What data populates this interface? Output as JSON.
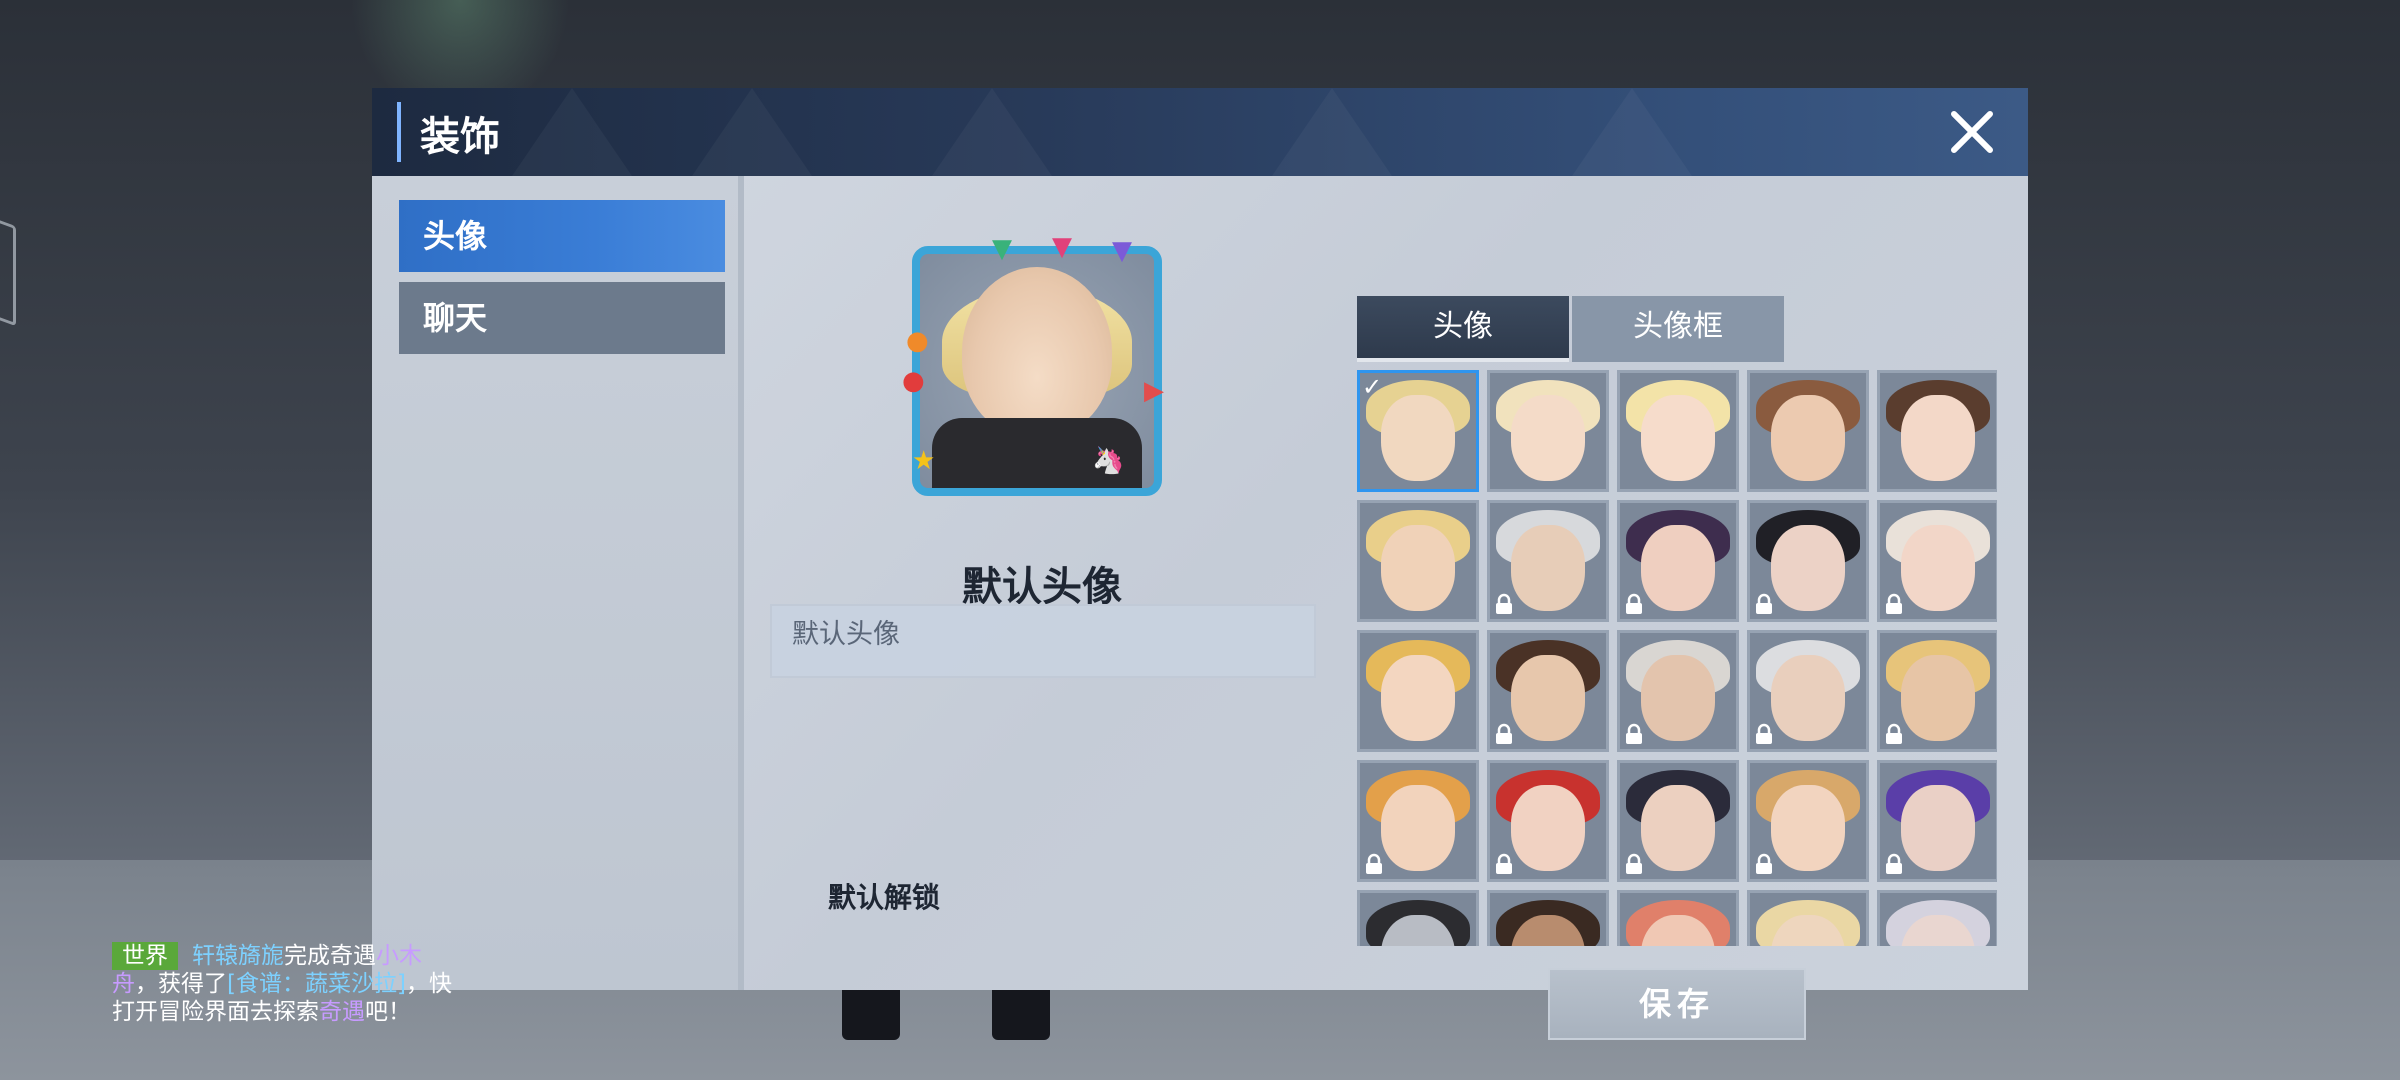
{
  "dialog": {
    "title": "装饰",
    "close_label": "close"
  },
  "sidebar": {
    "items": [
      {
        "label": "头像",
        "active": true
      },
      {
        "label": "聊天",
        "active": false
      }
    ]
  },
  "preview": {
    "name": "默认头像",
    "description": "默认头像",
    "unlock_condition": "默认解锁"
  },
  "tabs": [
    {
      "label": "头像",
      "active": true
    },
    {
      "label": "头像框",
      "active": false
    }
  ],
  "avatar_grid": {
    "rows": 5,
    "cols": 5,
    "selected_index": 0,
    "items": [
      {
        "hair": "#e6d292",
        "skin": "#f1d8c0",
        "locked": false
      },
      {
        "hair": "#f1e2bd",
        "skin": "#f4dbc8",
        "locked": false
      },
      {
        "hair": "#f3e3a8",
        "skin": "#f6dccb",
        "locked": false
      },
      {
        "hair": "#8a5b3f",
        "skin": "#eccab0",
        "locked": false
      },
      {
        "hair": "#5a3d2e",
        "skin": "#f3d8c8",
        "locked": false
      },
      {
        "hair": "#e9cf8a",
        "skin": "#f0d2b8",
        "locked": false
      },
      {
        "hair": "#d7d9dc",
        "skin": "#e7cdb8",
        "locked": true
      },
      {
        "hair": "#3e2d4e",
        "skin": "#efcfc0",
        "locked": true
      },
      {
        "hair": "#202026",
        "skin": "#ecd2c6",
        "locked": true
      },
      {
        "hair": "#e9e1d9",
        "skin": "#f2d6c8",
        "locked": true
      },
      {
        "hair": "#e5b95a",
        "skin": "#f3d6c0",
        "locked": false
      },
      {
        "hair": "#4a3226",
        "skin": "#e7c7ac",
        "locked": true
      },
      {
        "hair": "#d9d6d2",
        "skin": "#e3c4ad",
        "locked": true
      },
      {
        "hair": "#dcdde0",
        "skin": "#e9cfbd",
        "locked": true
      },
      {
        "hair": "#e7c47a",
        "skin": "#e7c5a6",
        "locked": true
      },
      {
        "hair": "#e3a04a",
        "skin": "#f2d3bc",
        "locked": true
      },
      {
        "hair": "#c8322e",
        "skin": "#f1d2c2",
        "locked": true
      },
      {
        "hair": "#2b2b3a",
        "skin": "#ecd0c0",
        "locked": true
      },
      {
        "hair": "#d8a86a",
        "skin": "#f2d4bf",
        "locked": true
      },
      {
        "hair": "#5a3ea8",
        "skin": "#ead0c6",
        "locked": true
      },
      {
        "hair": "#2c2c30",
        "skin": "#b8bcc4",
        "locked": false
      },
      {
        "hair": "#3a2a22",
        "skin": "#b88c6e",
        "locked": false
      },
      {
        "hair": "#e0806a",
        "skin": "#f0c8b4",
        "locked": false
      },
      {
        "hair": "#ead7a4",
        "skin": "#eed6be",
        "locked": false
      },
      {
        "hair": "#d4d2de",
        "skin": "#e9d6d0",
        "locked": false
      }
    ]
  },
  "save_label": "保存",
  "chat": {
    "channel": "世界",
    "player": "轩辕旖旎",
    "text1": "完成奇遇",
    "event_name": "小木舟",
    "text2": "，获得了",
    "item": "[食谱：蔬菜沙拉]",
    "text3": "，快打开冒险界面去探索",
    "event_word": "奇遇",
    "tail": "吧！"
  },
  "colors": {
    "accent_blue": "#2f6fc6",
    "title_bar": "#283a59",
    "frame_border": "#3ba5d8",
    "selection": "#2f95ef",
    "chat_channel": "#5aa83a"
  }
}
